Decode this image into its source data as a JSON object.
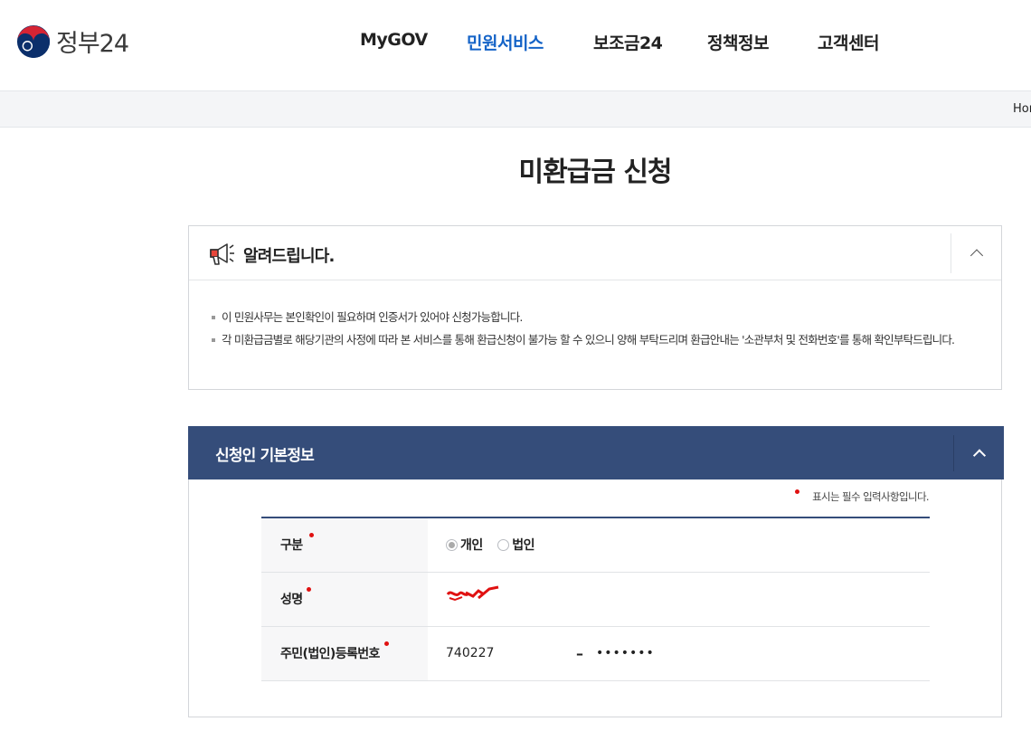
{
  "header": {
    "logo_text": "정부24",
    "nav": [
      {
        "label": "MyGOV",
        "active": false
      },
      {
        "label": "민원서비스",
        "active": true
      },
      {
        "label": "보조금24",
        "active": false
      },
      {
        "label": "정책정보",
        "active": false
      },
      {
        "label": "고객센터",
        "active": false
      }
    ]
  },
  "location": {
    "home": "Home"
  },
  "page": {
    "title": "미환급금 신청"
  },
  "notice": {
    "title": "알려드립니다.",
    "items": [
      "이 민원사무는 본인확인이 필요하며 인증서가 있어야 신청가능합니다.",
      "각 미환급금별로 해당기관의 사정에 따라 본 서비스를 통해 환급신청이 불가능 할 수 있으니 양해 부탁드리며 환급안내는 '소관부처 및 전화번호'를 통해 확인부탁드립니다."
    ]
  },
  "section": {
    "title": "신청인 기본정보",
    "required_note": "표시는 필수 입력사항입니다.",
    "rows": {
      "type": {
        "label": "구분",
        "options": [
          "개인",
          "법인"
        ],
        "selected": "개인"
      },
      "name": {
        "label": "성명"
      },
      "rrn": {
        "label": "주민(법인)등록번호",
        "front": "740227",
        "dash": "–",
        "back": "•••••••"
      }
    }
  },
  "colors": {
    "accent": "#1463c7",
    "section_header": "#354d7a",
    "required_dot": "#e01111"
  }
}
